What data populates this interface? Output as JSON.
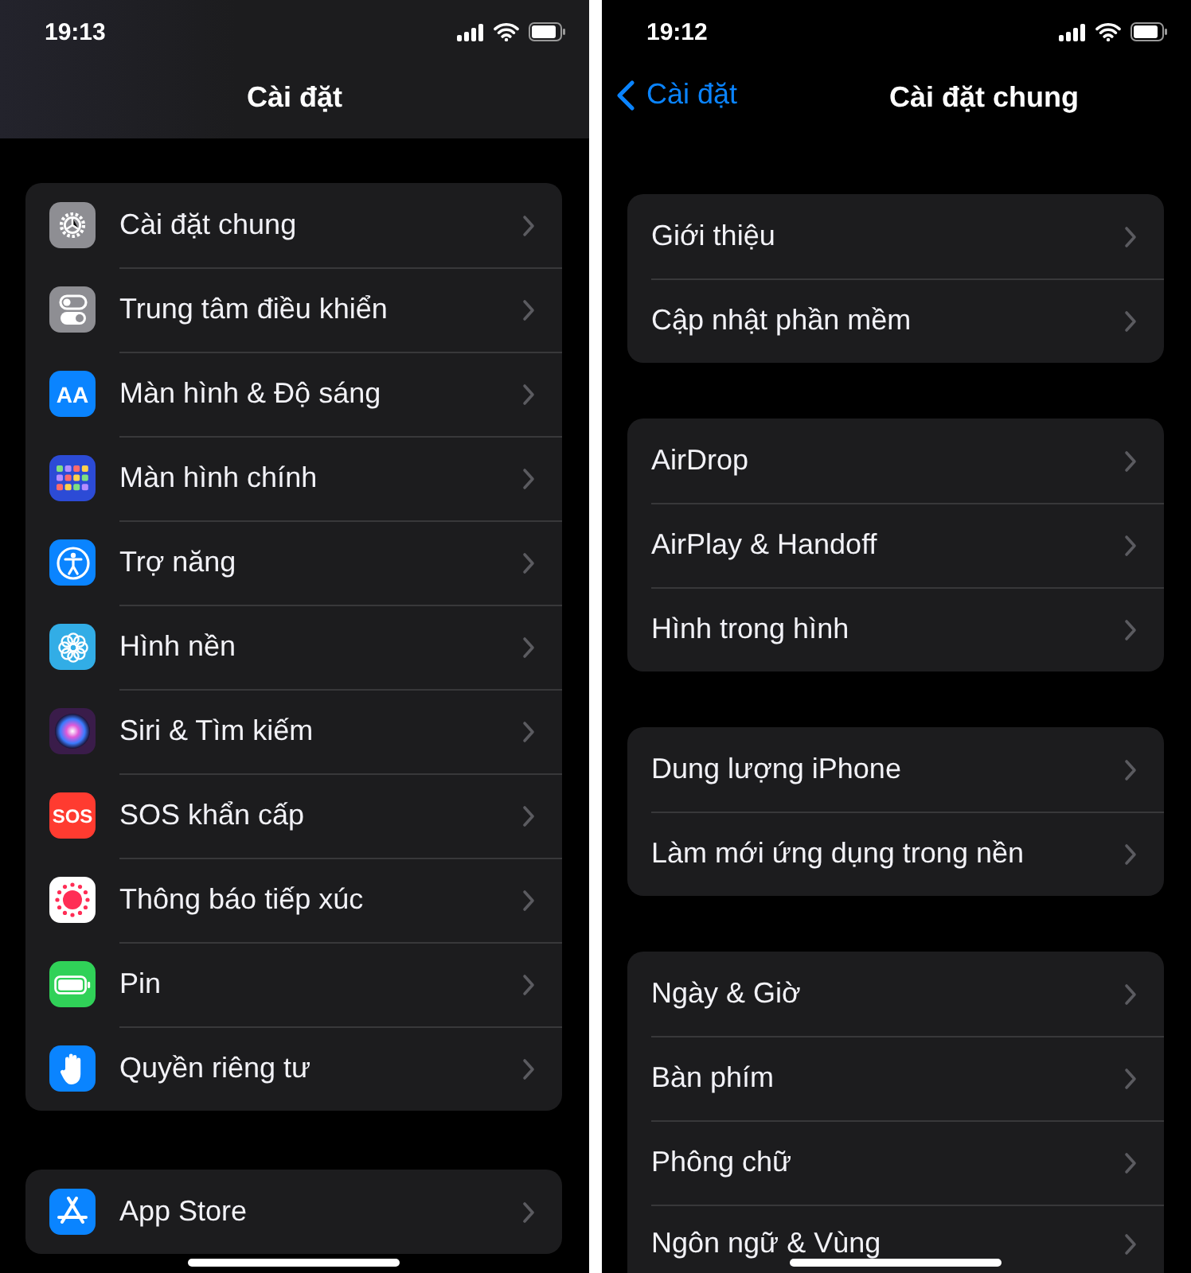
{
  "left_screen": {
    "status_bar": {
      "time": "19:13"
    },
    "title": "Cài đặt",
    "groups": [
      [
        {
          "label": "Cài đặt chung",
          "kind": "gear"
        },
        {
          "label": "Trung tâm điều khiển",
          "kind": "toggles"
        },
        {
          "label": "Màn hình & Độ sáng",
          "kind": "text",
          "icon_text": "AA"
        },
        {
          "label": "Màn hình chính",
          "kind": "grid"
        },
        {
          "label": "Trợ năng",
          "kind": "person"
        },
        {
          "label": "Hình nền",
          "kind": "flower"
        },
        {
          "label": "Siri & Tìm kiếm",
          "kind": "orb"
        },
        {
          "label": "SOS khẩn cấp",
          "kind": "sos",
          "icon_text": "SOS"
        },
        {
          "label": "Thông báo tiếp xúc",
          "kind": "dots"
        },
        {
          "label": "Pin",
          "kind": "battery"
        },
        {
          "label": "Quyền riêng tư",
          "kind": "hand"
        }
      ],
      [
        {
          "label": "App Store",
          "kind": "store"
        }
      ]
    ]
  },
  "right_screen": {
    "status_bar": {
      "time": "19:12"
    },
    "back_label": "Cài đặt",
    "title": "Cài đặt chung",
    "groups": [
      [
        "Giới thiệu",
        "Cập nhật phần mềm"
      ],
      [
        "AirDrop",
        "AirPlay & Handoff",
        "Hình trong hình"
      ],
      [
        "Dung lượng iPhone",
        "Làm mới ứng dụng trong nền"
      ],
      [
        "Ngày & Giờ",
        "Bàn phím",
        "Phông chữ",
        "Ngôn ngữ & Vùng"
      ]
    ]
  }
}
